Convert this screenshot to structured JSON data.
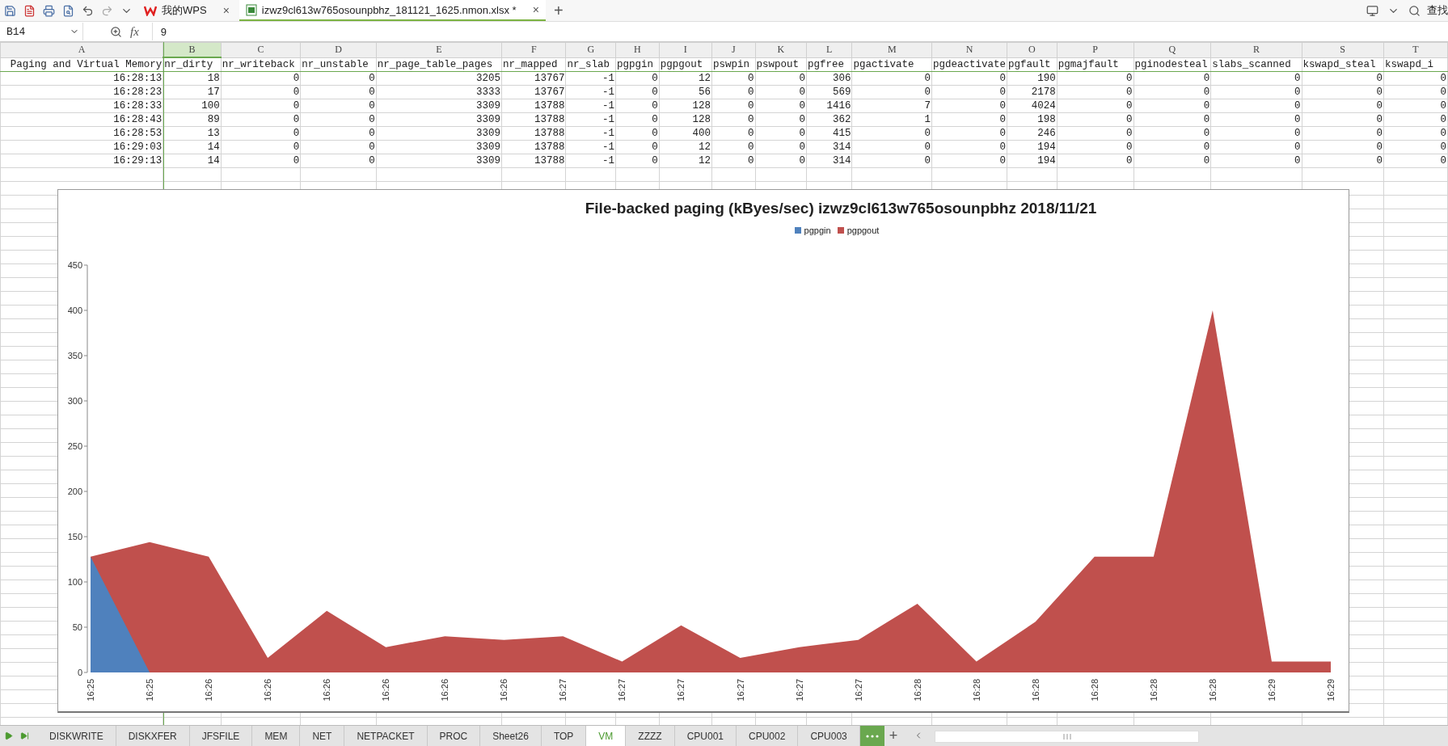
{
  "toolbar": {
    "tabs": [
      {
        "kind": "home",
        "label": "我的WPS",
        "close": "×",
        "selected": false
      },
      {
        "kind": "file",
        "label": "izwz9cl613w765osounpbhz_181121_1625.nmon.xlsx *",
        "close": "×",
        "selected": true
      }
    ],
    "new_tab": "+",
    "search_label": "查找"
  },
  "formula_bar": {
    "cell_ref": "B14",
    "fx": "fx",
    "value": "9"
  },
  "sheet": {
    "columns": [
      {
        "letter": "A",
        "selected": false
      },
      {
        "letter": "B",
        "selected": true
      },
      {
        "letter": "C",
        "selected": false
      },
      {
        "letter": "D",
        "selected": false
      },
      {
        "letter": "E",
        "selected": false
      },
      {
        "letter": "F",
        "selected": false
      },
      {
        "letter": "G",
        "selected": false
      },
      {
        "letter": "H",
        "selected": false
      },
      {
        "letter": "I",
        "selected": false
      },
      {
        "letter": "J",
        "selected": false
      },
      {
        "letter": "K",
        "selected": false
      },
      {
        "letter": "L",
        "selected": false
      },
      {
        "letter": "M",
        "selected": false
      },
      {
        "letter": "N",
        "selected": false
      },
      {
        "letter": "O",
        "selected": false
      },
      {
        "letter": "P",
        "selected": false
      },
      {
        "letter": "Q",
        "selected": false
      },
      {
        "letter": "R",
        "selected": false
      },
      {
        "letter": "S",
        "selected": false
      },
      {
        "letter": "T",
        "selected": false
      }
    ],
    "header_row": [
      "Paging and Virtual Memory",
      "nr_dirty",
      "nr_writeback",
      "nr_unstable",
      "nr_page_table_pages",
      "nr_mapped",
      "nr_slab",
      "pgpgin",
      "pgpgout",
      "pswpin",
      "pswpout",
      "pgfree",
      "pgactivate",
      "pgdeactivate",
      "pgfault",
      "pgmajfault",
      "pginodesteal",
      "slabs_scanned",
      "kswapd_steal",
      "kswapd_i"
    ],
    "rows": [
      [
        "16:28:13",
        "18",
        "0",
        "0",
        "3205",
        "13767",
        "-1",
        "0",
        "12",
        "0",
        "0",
        "306",
        "0",
        "0",
        "190",
        "0",
        "0",
        "0",
        "0",
        "0"
      ],
      [
        "16:28:23",
        "17",
        "0",
        "0",
        "3333",
        "13767",
        "-1",
        "0",
        "56",
        "0",
        "0",
        "569",
        "0",
        "0",
        "2178",
        "0",
        "0",
        "0",
        "0",
        "0"
      ],
      [
        "16:28:33",
        "100",
        "0",
        "0",
        "3309",
        "13788",
        "-1",
        "0",
        "128",
        "0",
        "0",
        "1416",
        "7",
        "0",
        "4024",
        "0",
        "0",
        "0",
        "0",
        "0"
      ],
      [
        "16:28:43",
        "89",
        "0",
        "0",
        "3309",
        "13788",
        "-1",
        "0",
        "128",
        "0",
        "0",
        "362",
        "1",
        "0",
        "198",
        "0",
        "0",
        "0",
        "0",
        "0"
      ],
      [
        "16:28:53",
        "13",
        "0",
        "0",
        "3309",
        "13788",
        "-1",
        "0",
        "400",
        "0",
        "0",
        "415",
        "0",
        "0",
        "246",
        "0",
        "0",
        "0",
        "0",
        "0"
      ],
      [
        "16:29:03",
        "14",
        "0",
        "0",
        "3309",
        "13788",
        "-1",
        "0",
        "12",
        "0",
        "0",
        "314",
        "0",
        "0",
        "194",
        "0",
        "0",
        "0",
        "0",
        "0"
      ],
      [
        "16:29:13",
        "14",
        "0",
        "0",
        "3309",
        "13788",
        "-1",
        "0",
        "12",
        "0",
        "0",
        "314",
        "0",
        "0",
        "194",
        "0",
        "0",
        "0",
        "0",
        "0"
      ]
    ]
  },
  "chart": {
    "chart_data": {
      "type": "area",
      "title": "File-backed paging (kByes/sec) izwz9cl613w765osounpbhz 2018/11/21",
      "categories": [
        "16:25",
        "16:25",
        "16:26",
        "16:26",
        "16:26",
        "16:26",
        "16:26",
        "16:26",
        "16:27",
        "16:27",
        "16:27",
        "16:27",
        "16:27",
        "16:27",
        "16:28",
        "16:28",
        "16:28",
        "16:28",
        "16:28",
        "16:28",
        "16:29",
        "16:29"
      ],
      "series": [
        {
          "name": "pgpgin",
          "color": "#4f81bd",
          "values": [
            128,
            0,
            0,
            0,
            0,
            0,
            0,
            0,
            0,
            0,
            0,
            0,
            0,
            0,
            0,
            0,
            0,
            0,
            0,
            0,
            0,
            0
          ]
        },
        {
          "name": "pgpgout",
          "color": "#c0504d",
          "values": [
            128,
            144,
            128,
            16,
            68,
            28,
            40,
            36,
            40,
            12,
            52,
            16,
            28,
            36,
            76,
            12,
            56,
            128,
            128,
            400,
            12,
            12
          ]
        }
      ],
      "ylim": [
        0,
        450
      ],
      "yticks": [
        0,
        50,
        100,
        150,
        200,
        250,
        300,
        350,
        400,
        450
      ]
    }
  },
  "sheet_tabs": [
    {
      "label": "DISKWRITE",
      "selected": false
    },
    {
      "label": "DISKXFER",
      "selected": false
    },
    {
      "label": "JFSFILE",
      "selected": false
    },
    {
      "label": "MEM",
      "selected": false
    },
    {
      "label": "NET",
      "selected": false
    },
    {
      "label": "NETPACKET",
      "selected": false
    },
    {
      "label": "PROC",
      "selected": false
    },
    {
      "label": "Sheet26",
      "selected": false
    },
    {
      "label": "TOP",
      "selected": false
    },
    {
      "label": "VM",
      "selected": true
    },
    {
      "label": "ZZZZ",
      "selected": false
    },
    {
      "label": "CPU001",
      "selected": false
    },
    {
      "label": "CPU002",
      "selected": false
    },
    {
      "label": "CPU003",
      "selected": false
    }
  ],
  "add_sheet": "+"
}
